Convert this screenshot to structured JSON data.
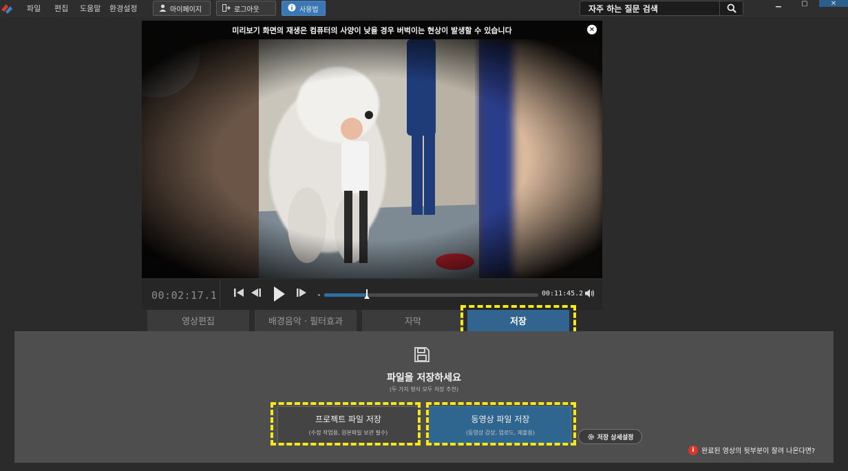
{
  "menu": {
    "file": "파일",
    "edit": "편집",
    "help": "도움말",
    "settings": "환경설정"
  },
  "toolbar": {
    "mypage": "마이페이지",
    "logout": "로그아웃",
    "manual": "사용법"
  },
  "search": {
    "placeholder": "자주 하는 질문 검색"
  },
  "preview": {
    "notice": "미리보기 화면의 재생은 컴퓨터의 사양이 낮을 경우 버벅이는 현상이 발생할 수 있습니다"
  },
  "player": {
    "current_time": "00:02:17.1",
    "duration": "00:11:45.2",
    "progress_fraction": 0.2
  },
  "tabs": [
    {
      "label": "영상편집"
    },
    {
      "label": "배경음악 · 필터효과"
    },
    {
      "label": "자막"
    },
    {
      "label": "저장"
    }
  ],
  "save_panel": {
    "title": "파일을 저장하세요",
    "subtitle": "(두 가지 형식 모두 저장 추천)",
    "project_button": {
      "label": "프로젝트 파일 저장",
      "note": "(수정 작업용, 원본파일 보관 필수)"
    },
    "video_button": {
      "label": "동영상 파일 저장",
      "note": "(동영상 감상, 업로드, 제출용)"
    },
    "detail_settings": "저장 상세설정",
    "help_link": "완료된 영상의 뒷부분이 잘려 나온다면?",
    "help_badge": "i"
  },
  "colors": {
    "accent": "#31648f",
    "highlight": "#f5ea16",
    "background": "#2b2b2b",
    "panel": "#4e4e4e"
  }
}
